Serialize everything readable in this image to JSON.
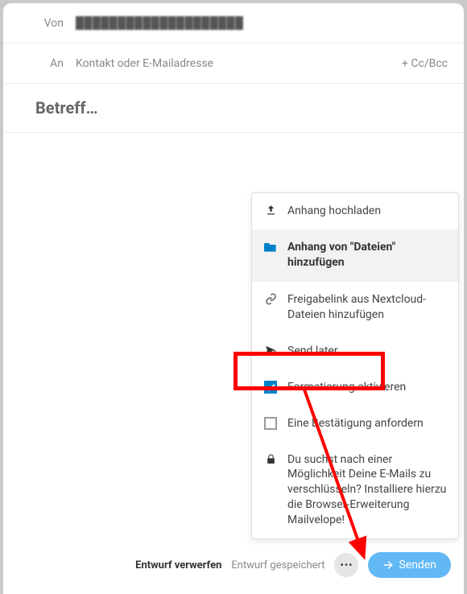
{
  "header": {
    "from_label": "Von",
    "from_value": "████████████████████",
    "to_label": "An",
    "to_placeholder": "Kontakt oder E-Mailadresse",
    "ccbcc_label": "+ Cc/Bcc"
  },
  "subject": {
    "placeholder": "Betreff…"
  },
  "menu": {
    "items": [
      {
        "icon": "upload",
        "label": "Anhang hochladen",
        "kind": "action"
      },
      {
        "icon": "folder",
        "label": "Anhang von \"Dateien\" hinzufügen",
        "kind": "action",
        "hover": true,
        "bold": true
      },
      {
        "icon": "link",
        "label": "Freigabelink aus Nextcloud-Dateien hinzufügen",
        "kind": "action"
      },
      {
        "icon": "send-later",
        "label": "Send later",
        "kind": "action",
        "highlighted": true
      },
      {
        "icon": "checkbox-checked",
        "label": "Formatierung aktivieren",
        "kind": "toggle",
        "checked": true
      },
      {
        "icon": "checkbox",
        "label": "Eine Bestätigung anfordern",
        "kind": "toggle",
        "checked": false
      },
      {
        "icon": "lock",
        "label": "Du suchst nach einer Möglichkeit Deine E-Mails zu verschlüsseln? Installiere hierzu die Browser-Erweiterung Mailvelope!",
        "kind": "info"
      }
    ]
  },
  "footer": {
    "discard": "Entwurf verwerfen",
    "saved": "Entwurf gespeichert",
    "send": "Senden"
  },
  "colors": {
    "accent": "#0082c9",
    "send_bg": "#62b8f5",
    "highlight": "#ff0000"
  }
}
